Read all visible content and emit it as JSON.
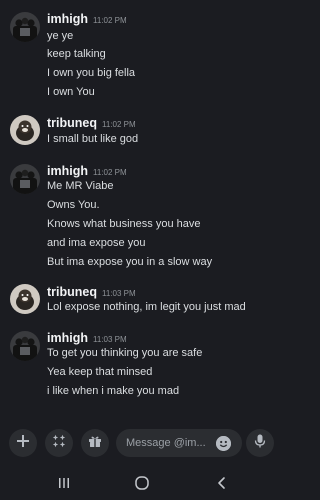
{
  "messages": [
    {
      "username": "imhigh",
      "time": "11:02 PM",
      "avatar": "imhigh-avatar",
      "lines": [
        "ye ye",
        "keep talking",
        "I own you big fella",
        "I own You"
      ]
    },
    {
      "username": "tribuneq",
      "time": "11:02 PM",
      "avatar": "tribuneq-avatar",
      "lines": [
        "I small but like god"
      ]
    },
    {
      "username": "imhigh",
      "time": "11:02 PM",
      "avatar": "imhigh-avatar",
      "lines": [
        "Me MR Viabe",
        "Owns You.",
        "Knows what business you have",
        "and ima expose you",
        "But ima expose you in a slow way"
      ]
    },
    {
      "username": "tribuneq",
      "time": "11:03 PM",
      "avatar": "tribuneq-avatar",
      "lines": [
        "Lol expose nothing, im legit you just mad"
      ]
    },
    {
      "username": "imhigh",
      "time": "11:03 PM",
      "avatar": "imhigh-avatar",
      "lines": [
        "To get you thinking you are safe",
        "Yea keep that minsed",
        "i like when i make you mad"
      ]
    }
  ],
  "composer": {
    "placeholder": "Message @im...",
    "icons": [
      "plus-icon",
      "apps-icon",
      "gift-icon",
      "emoji-icon",
      "microphone-icon"
    ]
  },
  "nav": {
    "icons": [
      "recents-icon",
      "home-icon",
      "back-icon"
    ]
  },
  "colors": {
    "background": "#1b1c21",
    "input_background": "#2b2d31",
    "text": "#dbdee1",
    "username": "#f2f3f5",
    "timestamp": "#8e9297"
  }
}
